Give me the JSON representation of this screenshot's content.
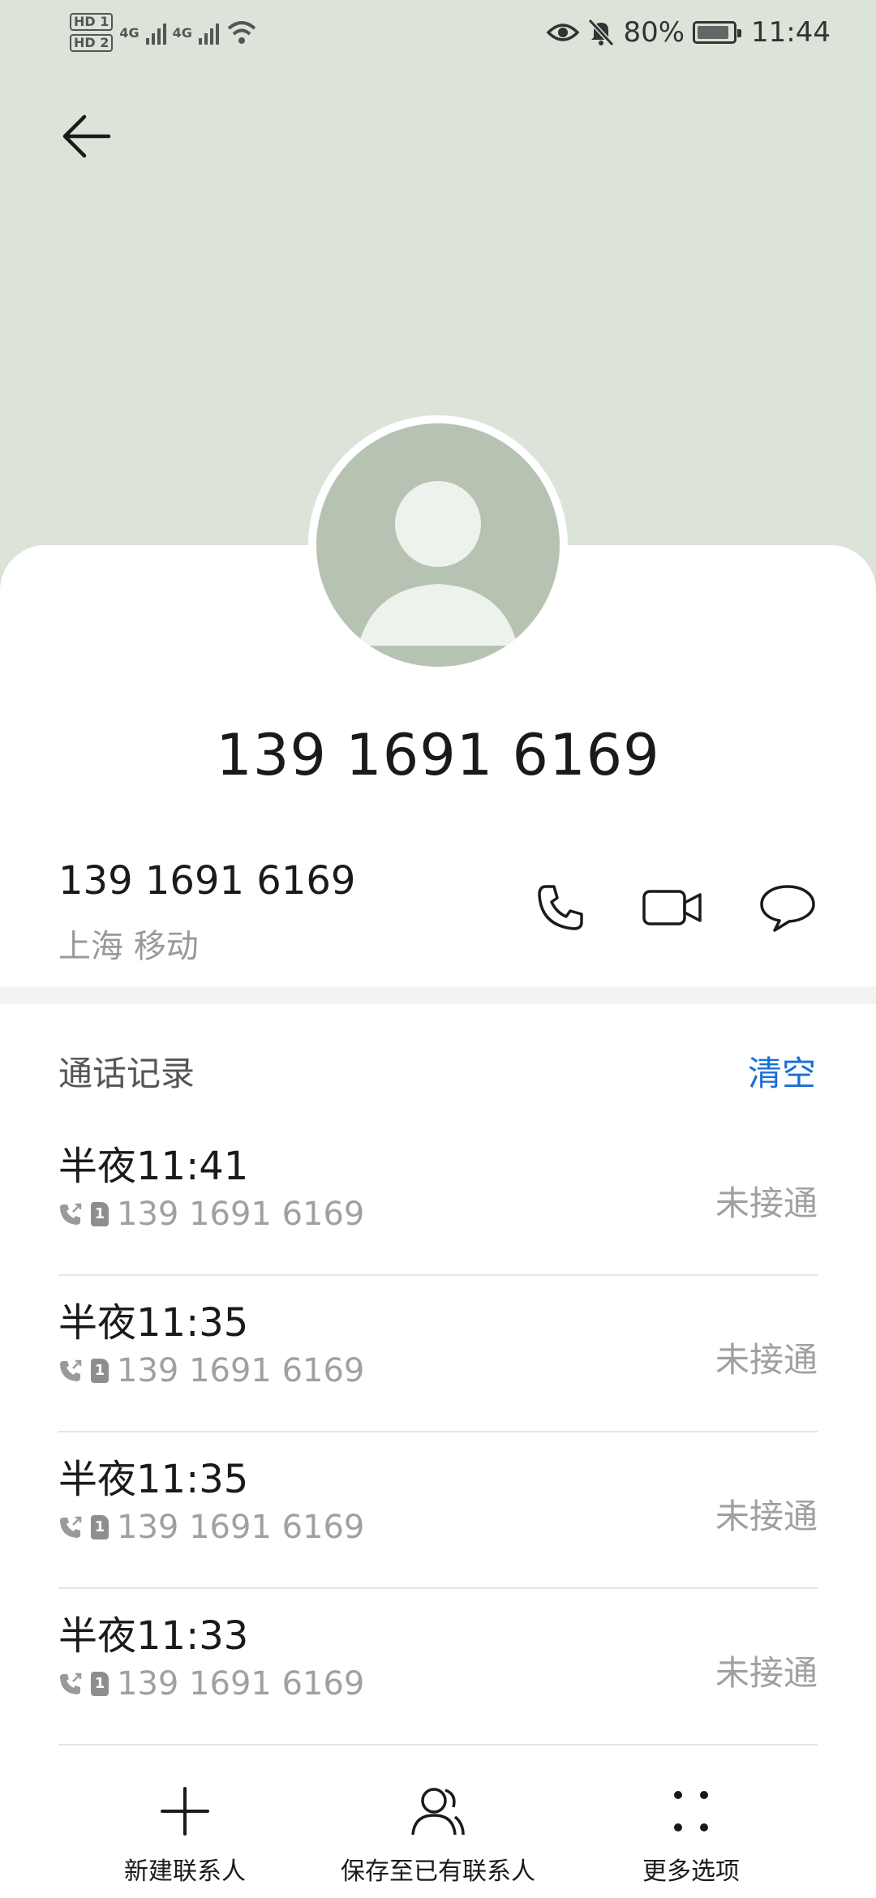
{
  "status_bar": {
    "hd1": "HD 1",
    "hd2": "HD 2",
    "net1": "4G",
    "net2": "4G",
    "battery": "80%",
    "time": "11:44"
  },
  "contact": {
    "display_number": "139 1691 6169",
    "number": "139 1691 6169",
    "location": "上海 移动"
  },
  "call_log": {
    "title": "通话记录",
    "clear_label": "清空",
    "items": [
      {
        "time": "半夜11:41",
        "sim": "1",
        "number": "139 1691 6169",
        "status": "未接通"
      },
      {
        "time": "半夜11:35",
        "sim": "1",
        "number": "139 1691 6169",
        "status": "未接通"
      },
      {
        "time": "半夜11:35",
        "sim": "1",
        "number": "139 1691 6169",
        "status": "未接通"
      },
      {
        "time": "半夜11:33",
        "sim": "1",
        "number": "139 1691 6169",
        "status": "未接通"
      }
    ]
  },
  "toolbar": {
    "new_contact": "新建联系人",
    "save_existing": "保存至已有联系人",
    "more_options": "更多选项"
  },
  "colors": {
    "header_bg": "#dce3d8",
    "avatar_bg": "#b6c3b3",
    "accent": "#1a6fd8"
  },
  "icons": [
    "back-arrow-icon",
    "phone-icon",
    "video-icon",
    "message-icon",
    "plus-icon",
    "contact-icon",
    "more-dots-icon"
  ]
}
